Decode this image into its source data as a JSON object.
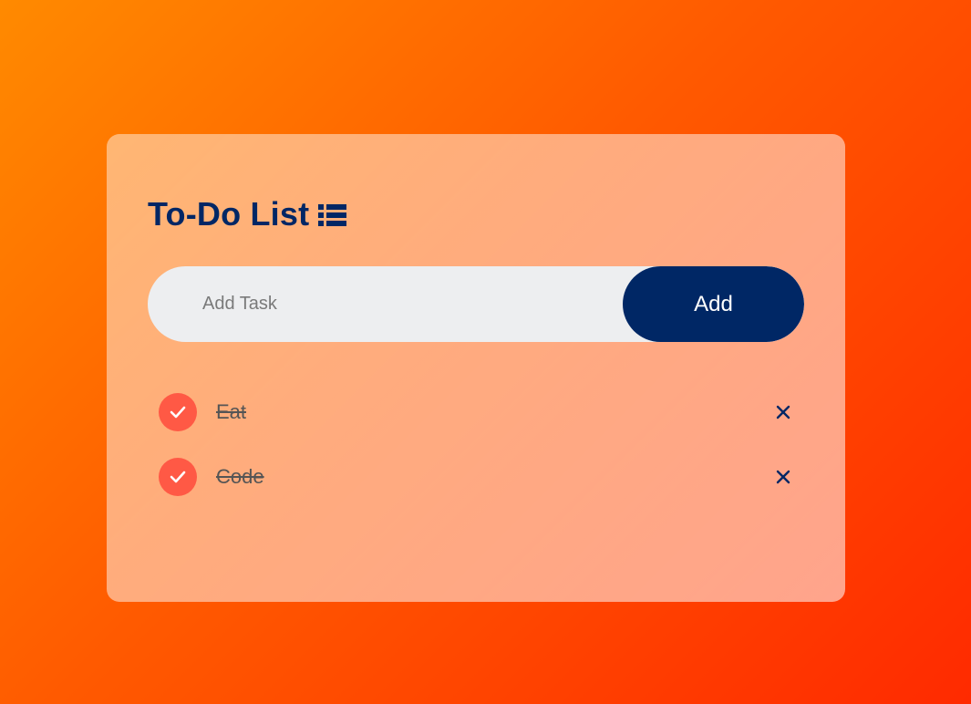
{
  "app": {
    "title": "To-Do List",
    "title_icon": "list-icon"
  },
  "input": {
    "placeholder": "Add Task",
    "value": "",
    "add_label": "Add"
  },
  "tasks": [
    {
      "label": "Eat",
      "checked": true
    },
    {
      "label": "Code",
      "checked": true
    }
  ],
  "colors": {
    "navy": "#002765",
    "check": "#ff5945",
    "background_start": "#ff8a00",
    "background_end": "#ff2a00"
  }
}
